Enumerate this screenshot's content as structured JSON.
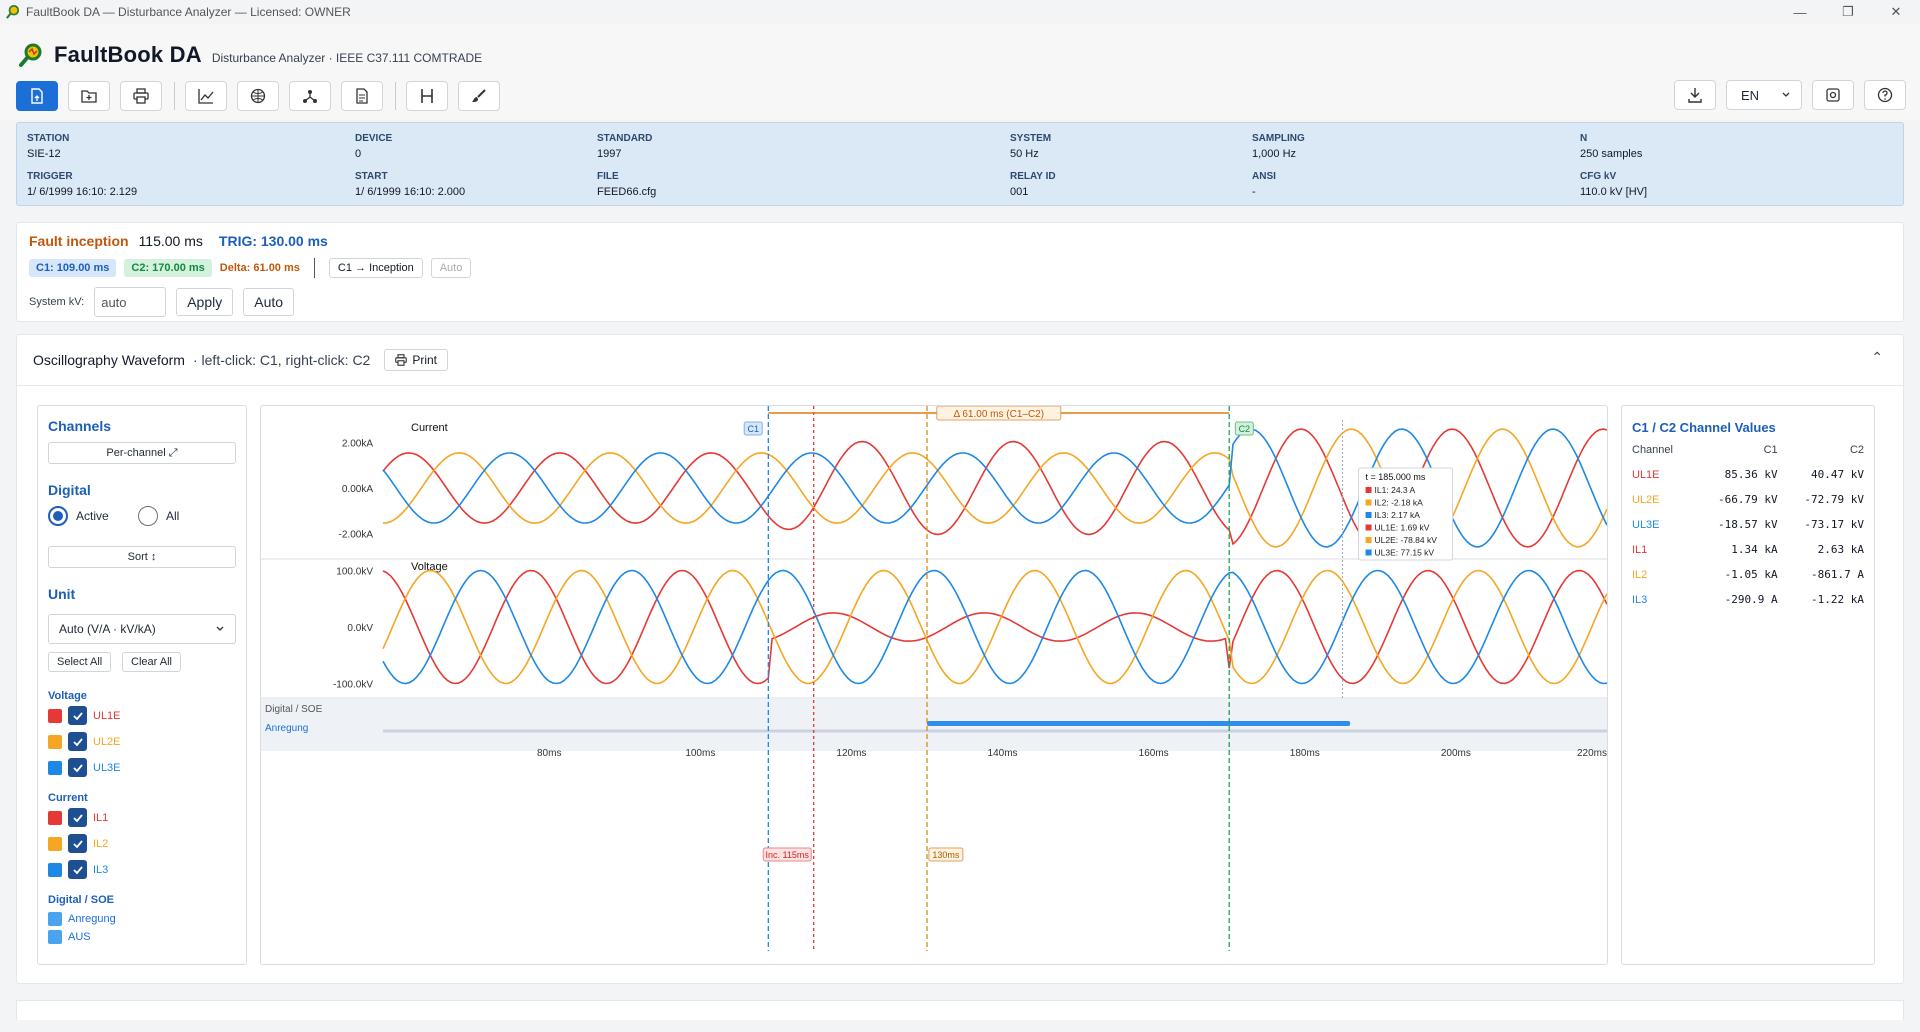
{
  "window": {
    "title": "FaultBook DA — Disturbance Analyzer  —  Licensed: OWNER"
  },
  "app": {
    "name": "FaultBook DA",
    "subtitle": "Disturbance Analyzer · IEEE C37.111 COMTRADE"
  },
  "toolbar": {
    "left_icons": [
      "open-file-icon",
      "folder-add-icon",
      "printer-icon",
      "chart-line-icon",
      "globe-icon",
      "network-icon",
      "document-icon",
      "cursor-h-icon",
      "brush-icon"
    ],
    "language": "EN",
    "right_icons": [
      "download-icon",
      "settings-icon",
      "help-icon"
    ]
  },
  "info": [
    {
      "label": "STATION",
      "value": "SIE-12"
    },
    {
      "label": "DEVICE",
      "value": "0"
    },
    {
      "label": "STANDARD",
      "value": "1997"
    },
    {
      "label": "SYSTEM",
      "value": "50 Hz"
    },
    {
      "label": "SAMPLING",
      "value": "1,000 Hz"
    },
    {
      "label": "N",
      "value": "250 samples"
    },
    {
      "label": "TRIGGER",
      "value": "1/ 6/1999 16:10: 2.129"
    },
    {
      "label": "START",
      "value": "1/ 6/1999 16:10: 2.000"
    },
    {
      "label": "FILE",
      "value": "FEED66.cfg"
    },
    {
      "label": "RELAY ID",
      "value": "001"
    },
    {
      "label": "ANSI",
      "value": "-"
    },
    {
      "label": "CFG kV",
      "value": "110.0 kV [HV]"
    }
  ],
  "fault": {
    "inception_label": "Fault inception",
    "inception_value": "115.00 ms",
    "trig": "TRIG: 130.00 ms",
    "c1": "C1: 109.00 ms",
    "c2": "C2: 170.00 ms",
    "delta": "Delta: 61.00 ms",
    "c1_btn": "C1 → Inception",
    "auto_btn": "Auto",
    "kv_label": "System kV:",
    "kv_value": "auto",
    "apply": "Apply",
    "auto": "Auto"
  },
  "waveform": {
    "title": "Oscillography Waveform",
    "hint": "·  left-click: C1, right-click: C2",
    "print": "Print"
  },
  "channels": {
    "title": "Channels",
    "per_channel": "Per-channel ⤢",
    "digital_title": "Digital",
    "radio_active": "Active",
    "radio_all": "All",
    "sort": "Sort ↕",
    "unit_title": "Unit",
    "unit_value": "Auto (V/A · kV/kA)",
    "select_all": "Select All",
    "clear_all": "Clear All",
    "voltage_group": "Voltage",
    "current_group": "Current",
    "digital_group": "Digital / SOE",
    "voltage": [
      {
        "name": "UL1E",
        "color": "#e53935"
      },
      {
        "name": "UL2E",
        "color": "#f5a623"
      },
      {
        "name": "UL3E",
        "color": "#1e88e5"
      }
    ],
    "current": [
      {
        "name": "IL1",
        "color": "#e53935"
      },
      {
        "name": "IL2",
        "color": "#f5a623"
      },
      {
        "name": "IL3",
        "color": "#1e88e5"
      }
    ],
    "digital": [
      "Anregung",
      "AUS"
    ]
  },
  "values": {
    "title": "C1 / C2 Channel Values",
    "headers": [
      "Channel",
      "C1",
      "C2"
    ],
    "rows": [
      {
        "ch": "UL1E",
        "c1": "85.36 kV",
        "c2": "40.47 kV",
        "color": "#e53935"
      },
      {
        "ch": "UL2E",
        "c1": "-66.79 kV",
        "c2": "-72.79 kV",
        "color": "#f5a623"
      },
      {
        "ch": "UL3E",
        "c1": "-18.57 kV",
        "c2": "-73.17 kV",
        "color": "#1e88e5"
      },
      {
        "ch": "IL1",
        "c1": "1.34 kA",
        "c2": "2.63 kA",
        "color": "#e53935"
      },
      {
        "ch": "IL2",
        "c1": "-1.05 kA",
        "c2": "-861.7 A",
        "color": "#f5a623"
      },
      {
        "ch": "IL3",
        "c1": "-290.9 A",
        "c2": "-1.22 kA",
        "color": "#1e88e5"
      }
    ]
  },
  "chart_data": {
    "type": "line",
    "x_unit": "ms",
    "xlim": [
      58,
      220
    ],
    "x_ticks": [
      "80ms",
      "100ms",
      "120ms",
      "140ms",
      "160ms",
      "180ms",
      "200ms",
      "220ms"
    ],
    "x_tick_values": [
      80,
      100,
      120,
      140,
      160,
      180,
      200,
      220
    ],
    "current_panel": {
      "label": "Current",
      "ticks": [
        "2.00kA",
        "0.00kA",
        "-2.00kA"
      ],
      "ylim": [
        -3.0,
        3.0
      ]
    },
    "voltage_panel": {
      "label": "Voltage",
      "ticks": [
        "100.0kV",
        "0.0kV",
        "-100.0kV"
      ],
      "ylim": [
        -115,
        115
      ]
    },
    "digital_panel": {
      "label": "Digital / SOE",
      "channel": "Anregung",
      "active_from": 130,
      "active_to": 186
    },
    "series": [
      {
        "name": "IL1",
        "panel": "current",
        "color": "#e53935"
      },
      {
        "name": "IL2",
        "panel": "current",
        "color": "#f5a623"
      },
      {
        "name": "IL3",
        "panel": "current",
        "color": "#1e88e5"
      },
      {
        "name": "UL1E",
        "panel": "voltage",
        "color": "#e53935"
      },
      {
        "name": "UL2E",
        "panel": "voltage",
        "color": "#f5a623"
      },
      {
        "name": "UL3E",
        "panel": "voltage",
        "color": "#1e88e5"
      }
    ],
    "markers": {
      "c1": {
        "t": 109,
        "label": "C1",
        "color": "#1e88e5"
      },
      "c2": {
        "t": 170,
        "label": "C2",
        "color": "#20a050"
      },
      "inception": {
        "t": 115,
        "label": "Inc. 115ms",
        "color": "#e53935"
      },
      "trig": {
        "t": 130,
        "label": "130ms",
        "color": "#e08a10"
      },
      "hover": {
        "t": 185
      }
    },
    "delta_label": "Δ 61.00 ms (C1–C2)",
    "tooltip": {
      "title": "t = 185.000 ms",
      "rows": [
        {
          "text": "IL1: 24.3 A",
          "color": "#e53935"
        },
        {
          "text": "IL2: -2.18 kA",
          "color": "#f5a623"
        },
        {
          "text": "IL3: 2.17 kA",
          "color": "#1e88e5"
        },
        {
          "text": "UL1E: 1.69 kV",
          "color": "#e53935"
        },
        {
          "text": "UL2E: -78.84 kV",
          "color": "#f5a623"
        },
        {
          "text": "UL3E: 77.15 kV",
          "color": "#1e88e5"
        }
      ]
    }
  }
}
